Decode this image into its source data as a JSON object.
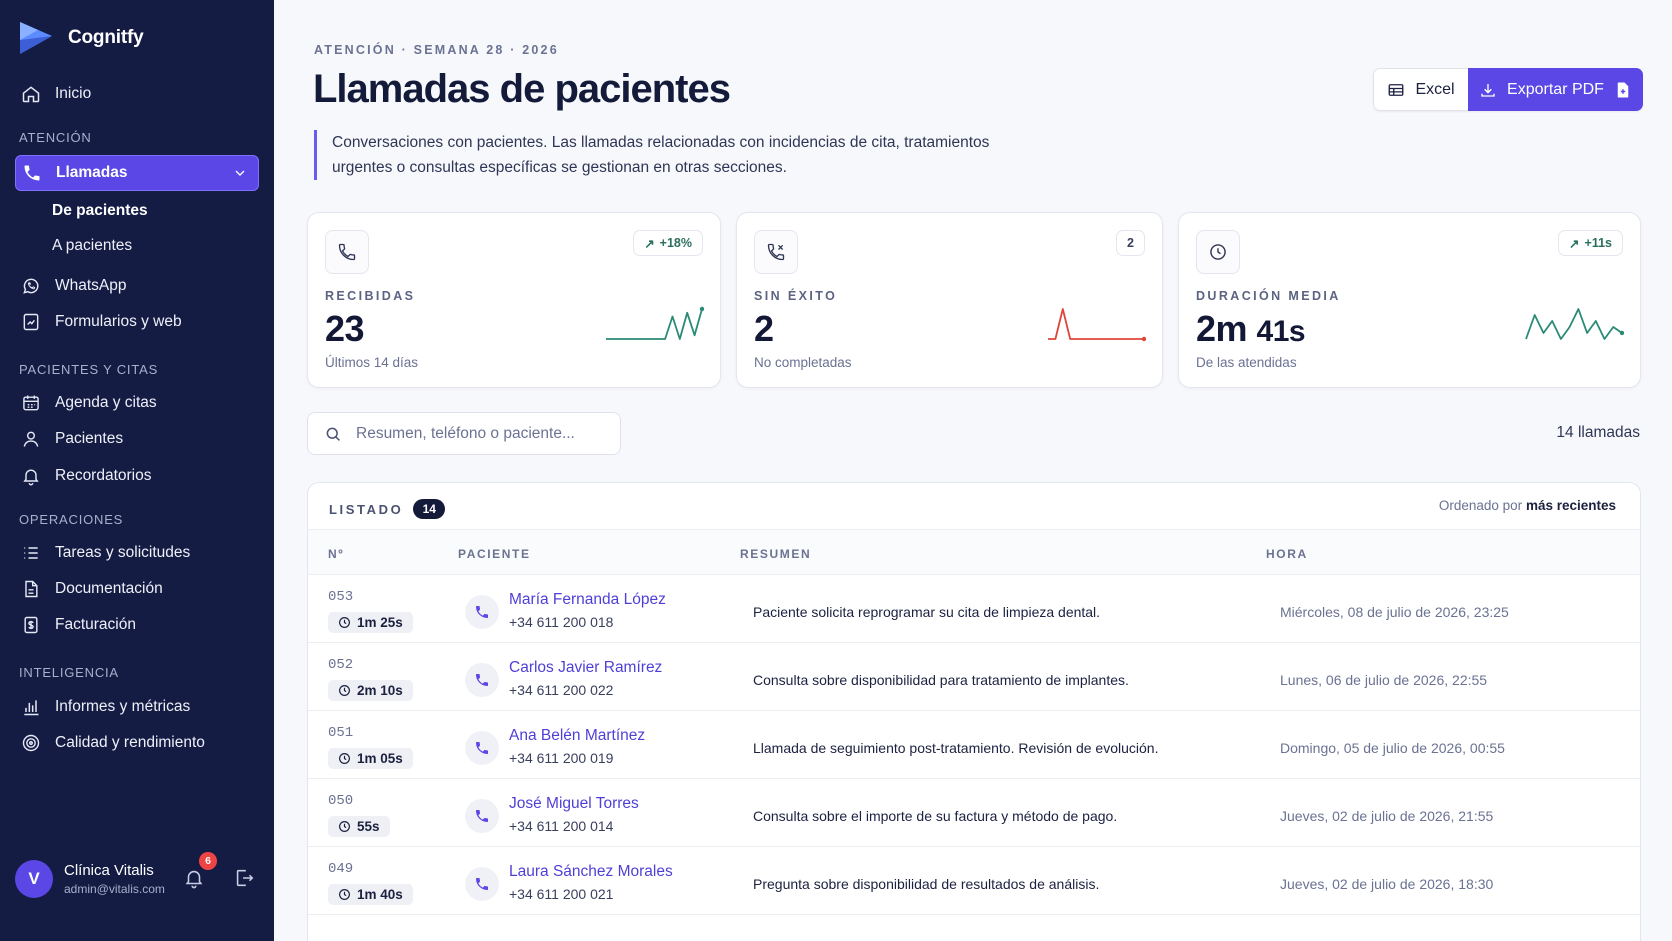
{
  "sidebar": {
    "brand": "Cognitfy",
    "home": "Inicio",
    "sections": {
      "atencion": "ATENCIÓN",
      "pacientes": "PACIENTES Y CITAS",
      "operaciones": "OPERACIONES",
      "inteligencia": "INTELIGENCIA"
    },
    "items": {
      "llamadas": "Llamadas",
      "de_pacientes": "De pacientes",
      "a_pacientes": "A pacientes",
      "whatsapp": "WhatsApp",
      "formularios": "Formularios y web",
      "agenda": "Agenda y citas",
      "pacientes": "Pacientes",
      "recordatorios": "Recordatorios",
      "tareas": "Tareas y solicitudes",
      "documentacion": "Documentación",
      "facturacion": "Facturación",
      "informes": "Informes y métricas",
      "calidad": "Calidad y rendimiento"
    },
    "user": {
      "initial": "V",
      "name": "Clínica Vitalis",
      "email": "admin@vitalis.com",
      "notifications": "6"
    }
  },
  "header": {
    "eyebrow": "ATENCIÓN · SEMANA 28 · 2026",
    "title": "Llamadas de pacientes",
    "description": "Conversaciones con pacientes. Las llamadas relacionadas con incidencias de cita, tratamientos urgentes o consultas específicas se gestionan en otras secciones.",
    "excel_label": "Excel",
    "pdf_label": "Exportar PDF"
  },
  "kpis": {
    "recibidas": {
      "label": "RECIBIDAS",
      "value": "23",
      "sub": "Últimos 14 días",
      "badge": "+18%",
      "spark": [
        2,
        2,
        2,
        2,
        2,
        2,
        2,
        2,
        2,
        8,
        2,
        9,
        3,
        10
      ]
    },
    "sin_exito": {
      "label": "SIN ÉXITO",
      "value": "2",
      "sub": "No completadas",
      "badge": "2",
      "spark": [
        0,
        0,
        6,
        0,
        0,
        0,
        0,
        0,
        0,
        0,
        0,
        0,
        0,
        0
      ]
    },
    "duracion": {
      "label": "DURACIÓN MEDIA",
      "value_main": "2m",
      "value_small": "41s",
      "sub": "De las atendidas",
      "badge": "+11s",
      "spark": [
        3,
        7,
        4,
        6,
        3,
        5,
        8,
        4,
        6,
        3,
        5,
        4
      ]
    }
  },
  "colors": {
    "accent": "#5b47e6",
    "sidebar": "#141c44",
    "positive": "#2a8a76",
    "negative": "#e0453a"
  },
  "search": {
    "placeholder": "Resumen, teléfono o paciente..."
  },
  "count_label": "14 llamadas",
  "list": {
    "label": "LISTADO",
    "badge": "14",
    "sort_prefix": "Ordenado por",
    "sort_value": "más recientes",
    "columns": [
      "Nº",
      "PACIENTE",
      "RESUMEN",
      "HORA"
    ],
    "rows": [
      {
        "num": "053",
        "duration": "1m 25s",
        "name": "María Fernanda López",
        "phone": "+34 611 200 018",
        "summary": "Paciente solicita reprogramar su cita de limpieza dental.",
        "time": "Miércoles, 08 de julio de 2026, 23:25"
      },
      {
        "num": "052",
        "duration": "2m 10s",
        "name": "Carlos Javier Ramírez",
        "phone": "+34 611 200 022",
        "summary": "Consulta sobre disponibilidad para tratamiento de implantes.",
        "time": "Lunes, 06 de julio de 2026, 22:55"
      },
      {
        "num": "051",
        "duration": "1m 05s",
        "name": "Ana Belén Martínez",
        "phone": "+34 611 200 019",
        "summary": "Llamada de seguimiento post-tratamiento. Revisión de evolución.",
        "time": "Domingo, 05 de julio de 2026, 00:55"
      },
      {
        "num": "050",
        "duration": "55s",
        "name": "José Miguel Torres",
        "phone": "+34 611 200 014",
        "summary": "Consulta sobre el importe de su factura y método de pago.",
        "time": "Jueves, 02 de julio de 2026, 21:55"
      },
      {
        "num": "049",
        "duration": "1m 40s",
        "name": "Laura Sánchez Morales",
        "phone": "+34 611 200 021",
        "summary": "Pregunta sobre disponibilidad de resultados de análisis.",
        "time": "Jueves, 02 de julio de 2026, 18:30"
      }
    ]
  }
}
